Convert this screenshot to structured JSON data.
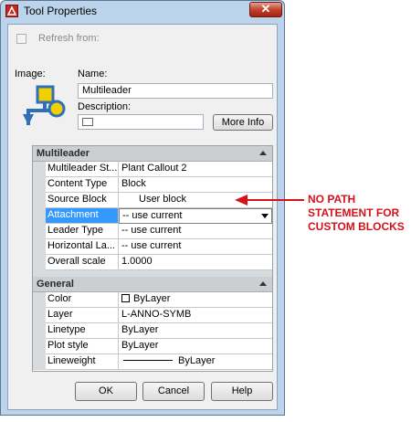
{
  "window": {
    "title": "Tool Properties",
    "close_glyph": "✕"
  },
  "refresh": {
    "label": "Refresh from:"
  },
  "image": {
    "label": "Image:",
    "icon": "multileader-icon"
  },
  "name": {
    "label": "Name:",
    "value": "Multileader"
  },
  "description": {
    "label": "Description:",
    "value": ""
  },
  "more_info": {
    "label": "More Info"
  },
  "sections": {
    "multileader": "Multileader",
    "general": "General"
  },
  "multileader_rows": [
    {
      "name": "Multileader St...",
      "value": "Plant Callout 2"
    },
    {
      "name": "Content Type",
      "value": "Block"
    },
    {
      "name": "Source Block",
      "value": "User block"
    },
    {
      "name": "Attachment",
      "value": "-- use current"
    },
    {
      "name": "Leader Type",
      "value": "-- use current"
    },
    {
      "name": "Horizontal La...",
      "value": "-- use current"
    },
    {
      "name": "Overall scale",
      "value": "1.0000"
    }
  ],
  "general_rows": [
    {
      "name": "Color",
      "value": "ByLayer"
    },
    {
      "name": "Layer",
      "value": "L-ANNO-SYMB"
    },
    {
      "name": "Linetype",
      "value": "ByLayer"
    },
    {
      "name": "Plot style",
      "value": "ByLayer"
    },
    {
      "name": "Lineweight",
      "value": "ByLayer"
    }
  ],
  "buttons": {
    "ok": "OK",
    "cancel": "Cancel",
    "help": "Help"
  },
  "annotation": {
    "line1": "NO PATH",
    "line2": "STATEMENT FOR",
    "line3": "CUSTOM BLOCKS"
  },
  "colors": {
    "annotation": "#d5121a",
    "selection": "#3399ff",
    "icon_blue": "#2f6fb7",
    "icon_yellow": "#f0d000"
  }
}
